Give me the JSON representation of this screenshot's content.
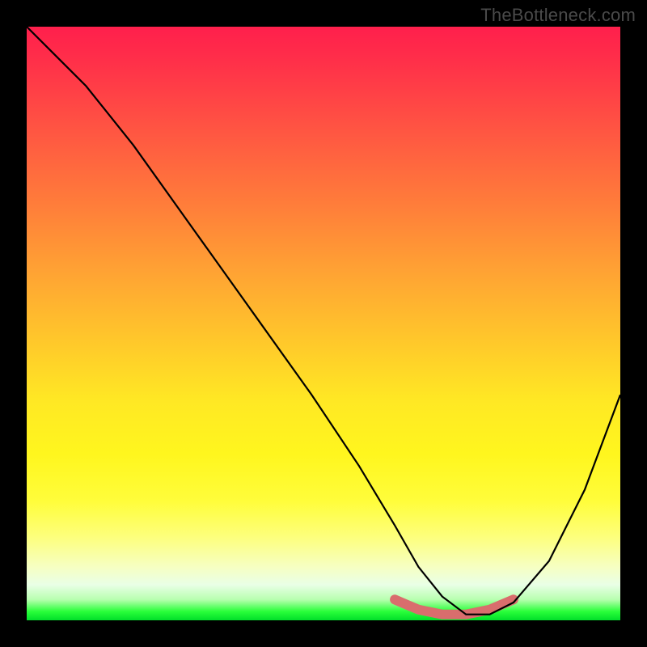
{
  "watermark": "TheBottleneck.com",
  "chart_data": {
    "type": "line",
    "title": "",
    "xlabel": "",
    "ylabel": "",
    "xlim": [
      0,
      100
    ],
    "ylim": [
      0,
      100
    ],
    "grid": false,
    "series": [
      {
        "name": "curve",
        "x": [
          0,
          5,
          10,
          18,
          28,
          38,
          48,
          56,
          62,
          66,
          70,
          74,
          78,
          82,
          88,
          94,
          100
        ],
        "y": [
          100,
          95,
          90,
          80,
          66,
          52,
          38,
          26,
          16,
          9,
          4,
          1,
          1,
          3,
          10,
          22,
          38
        ]
      }
    ],
    "annotations": [
      {
        "name": "bottom-accent",
        "x": [
          62,
          66,
          70,
          74,
          78,
          82
        ],
        "y": [
          3.5,
          1.8,
          1.0,
          1.0,
          1.8,
          3.5
        ],
        "color": "#d96d6d"
      }
    ],
    "background": "vertical rainbow gradient red→orange→yellow→green"
  }
}
